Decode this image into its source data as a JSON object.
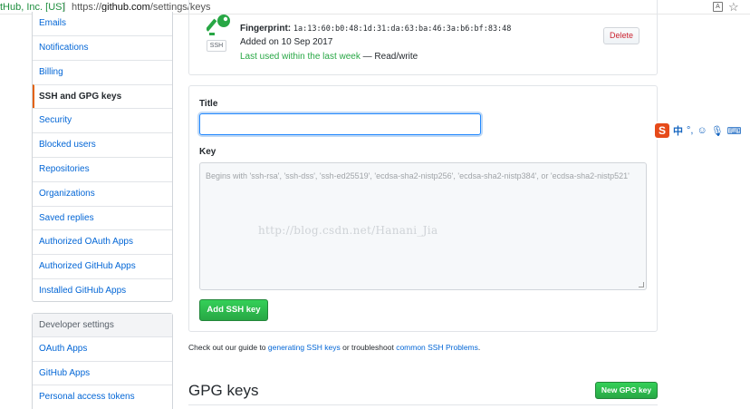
{
  "browser": {
    "org": "tHub, Inc. [US]",
    "separator": "|",
    "url_prefix": "https://",
    "url_host": "github.com",
    "url_path": "/settings/keys",
    "translate_glyph": "A",
    "star_glyph": "☆"
  },
  "menu": {
    "items": [
      {
        "label": "Emails"
      },
      {
        "label": "Notifications"
      },
      {
        "label": "Billing"
      },
      {
        "label": "SSH and GPG keys"
      },
      {
        "label": "Security"
      },
      {
        "label": "Blocked users"
      },
      {
        "label": "Repositories"
      },
      {
        "label": "Organizations"
      },
      {
        "label": "Saved replies"
      },
      {
        "label": "Authorized OAuth Apps"
      },
      {
        "label": "Authorized GitHub Apps"
      },
      {
        "label": "Installed GitHub Apps"
      }
    ],
    "selected_index": 3
  },
  "developer": {
    "header": "Developer settings",
    "items": [
      {
        "label": "OAuth Apps"
      },
      {
        "label": "GitHub Apps"
      },
      {
        "label": "Personal access tokens"
      }
    ]
  },
  "key": {
    "badge": "SSH",
    "fingerprint_label": "Fingerprint:",
    "fingerprint_value": "1a:13:60:b0:48:1d:31:da:63:ba:46:3a:b6:bf:83:48",
    "added": "Added on 10 Sep 2017",
    "last_used": "Last used within the last week",
    "access": " — Read/write",
    "delete_label": "Delete"
  },
  "form": {
    "title_label": "Title",
    "title_value": "",
    "key_label": "Key",
    "key_placeholder": "Begins with 'ssh-rsa', 'ssh-dss', 'ssh-ed25519', 'ecdsa-sha2-nistp256', 'ecdsa-sha2-nistp384', or 'ecdsa-sha2-nistp521'",
    "watermark": "http://blog.csdn.net/Hanani_Jia",
    "add_button": "Add SSH key"
  },
  "guide": {
    "prefix": "Check out our guide to ",
    "link1": "generating SSH keys",
    "middle": " or troubleshoot ",
    "link2": "common SSH Problems",
    "suffix": "."
  },
  "gpg": {
    "title": "GPG keys",
    "new_button": "New GPG key"
  },
  "ime": {
    "logo": "S",
    "chinese": "中",
    "punct": "°,",
    "smile": "☺",
    "mic": "🎙",
    "keyboard": "⌨"
  },
  "colors": {
    "accent": "#e36209",
    "link": "#0366d6",
    "green": "#28a745",
    "danger": "#cb2431"
  }
}
